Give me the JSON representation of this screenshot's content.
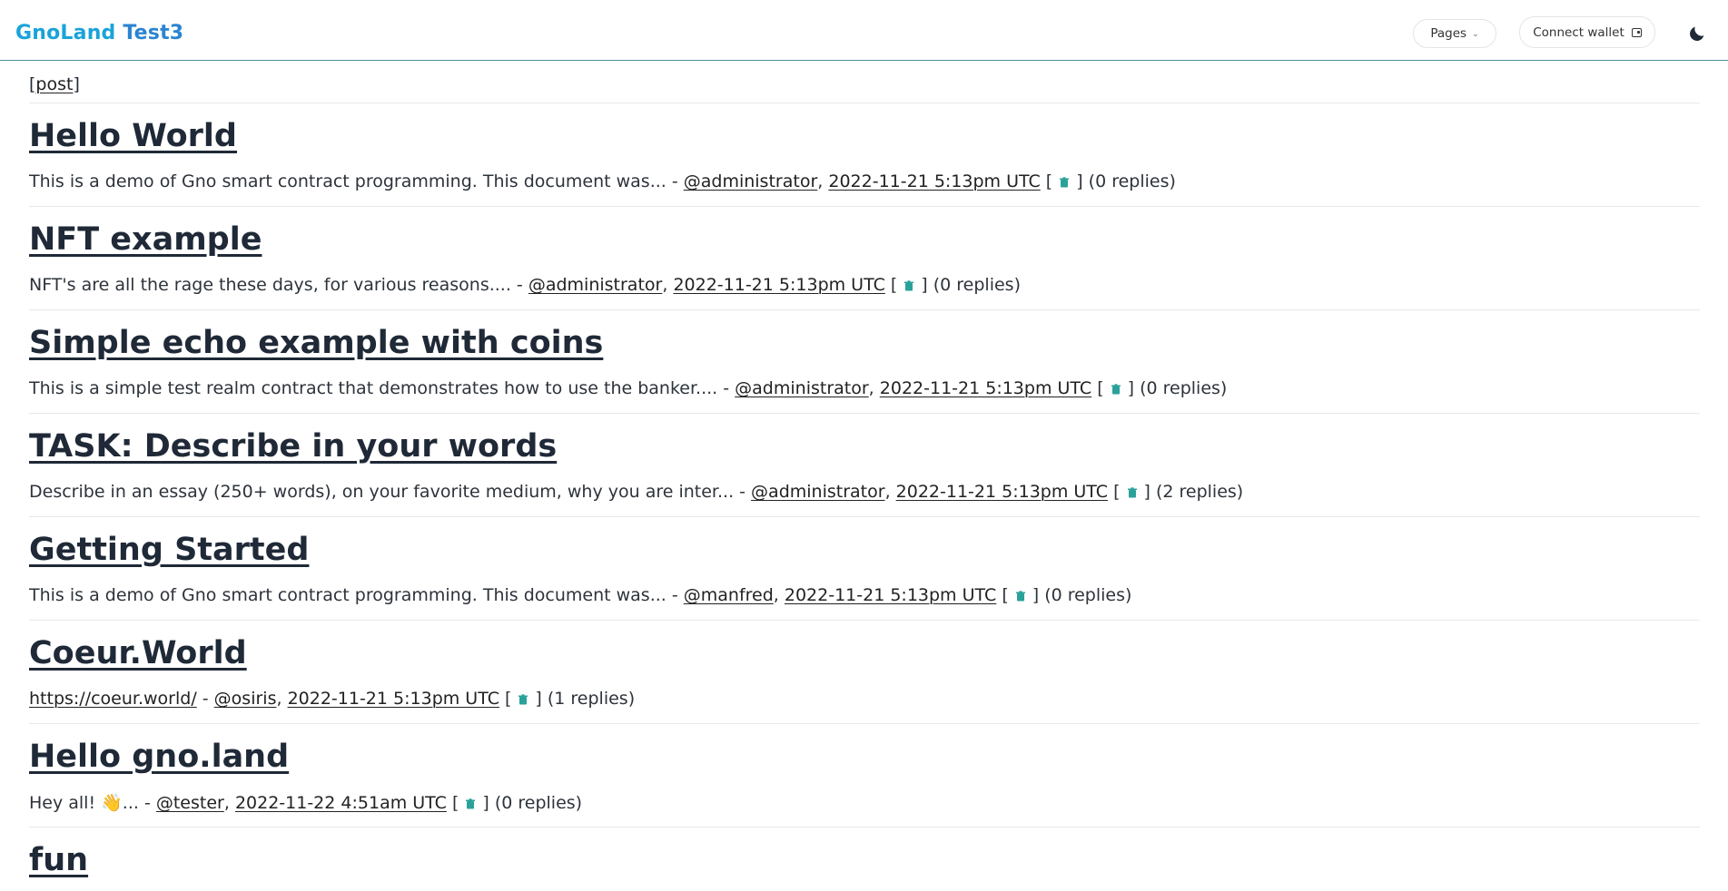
{
  "header": {
    "brand_part1": "GnoLand",
    "brand_part2": "Test3",
    "pages_label": "Pages",
    "wallet_label": "Connect wallet",
    "brand_color": "#1aa3d9",
    "accent_color": "#4f8f9e"
  },
  "post_link": "post",
  "threads": [
    {
      "title": "Hello World",
      "summary": "This is a demo of Gno smart contract programming. This document was...",
      "author": "@administrator",
      "date": "2022-11-21 5:13pm UTC",
      "replies": "(0 replies)"
    },
    {
      "title": "NFT example",
      "summary": "NFT's are all the rage these days, for various reasons....",
      "author": "@administrator",
      "date": "2022-11-21 5:13pm UTC",
      "replies": "(0 replies)"
    },
    {
      "title": "Simple echo example with coins",
      "summary": "This is a simple test realm contract that demonstrates how to use the banker....",
      "author": "@administrator",
      "date": "2022-11-21 5:13pm UTC",
      "replies": "(0 replies)"
    },
    {
      "title": "TASK: Describe in your words",
      "summary": "Describe in an essay (250+ words), on your favorite medium, why you are inter...",
      "author": "@administrator",
      "date": "2022-11-21 5:13pm UTC",
      "replies": "(2 replies)"
    },
    {
      "title": "Getting Started",
      "summary": "This is a demo of Gno smart contract programming. This document was...",
      "author": "@manfred",
      "date": "2022-11-21 5:13pm UTC",
      "replies": "(0 replies)"
    },
    {
      "title": "Coeur.World",
      "summary_link": "https://coeur.world/",
      "author": "@osiris",
      "date": "2022-11-21 5:13pm UTC",
      "replies": "(1 replies)"
    },
    {
      "title": "Hello gno.land",
      "summary": "Hey all! 👋...",
      "author": "@tester",
      "date": "2022-11-22 4:51am UTC",
      "replies": "(0 replies)"
    },
    {
      "title": "fun"
    }
  ],
  "icons": {
    "delete": "trash-icon",
    "theme": "moon-icon",
    "wallet": "wallet-icon",
    "dropdown": "chevron-down-icon"
  }
}
